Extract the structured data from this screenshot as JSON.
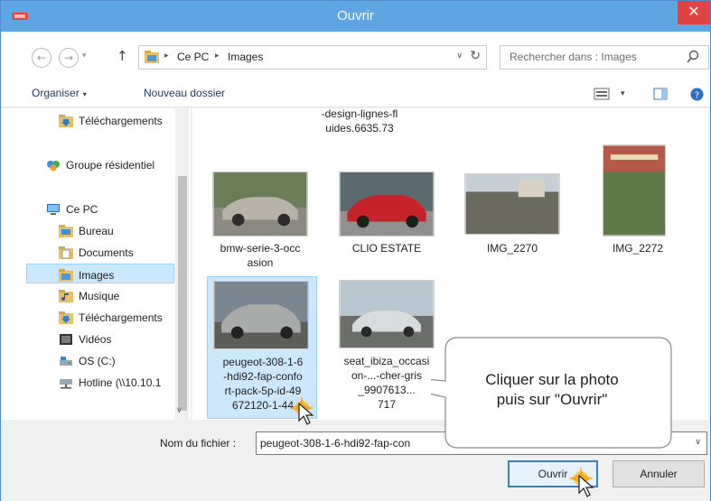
{
  "window": {
    "title": "Ouvrir",
    "close_glyph": "✕",
    "accent": "#5ea5e3"
  },
  "nav": {
    "back_glyph": "←",
    "forward_glyph": "→",
    "dropdown_glyph": "▾",
    "up_glyph": "↑",
    "breadcrumbs": [
      "Ce PC",
      "Images"
    ],
    "crumb_sep": "▸",
    "refresh_glyph": "↻",
    "addr_dropdown": "∨",
    "search_placeholder": "Rechercher dans : Images"
  },
  "commands": {
    "organize": "Organiser",
    "organize_caret": "▾",
    "new_folder": "Nouveau dossier",
    "view_caret": "▾"
  },
  "tree": [
    {
      "label": "Téléchargements",
      "icon": "downloads-folder-icon"
    },
    {
      "label": "Groupe résidentiel",
      "icon": "homegroup-icon"
    },
    {
      "label": "Ce PC",
      "icon": "computer-icon"
    },
    {
      "label": "Bureau",
      "icon": "desktop-folder-icon"
    },
    {
      "label": "Documents",
      "icon": "documents-folder-icon"
    },
    {
      "label": "Images",
      "icon": "pictures-folder-icon"
    },
    {
      "label": "Musique",
      "icon": "music-folder-icon"
    },
    {
      "label": "Téléchargements",
      "icon": "downloads-folder-icon"
    },
    {
      "label": "Vidéos",
      "icon": "videos-folder-icon"
    },
    {
      "label": "OS (C:)",
      "icon": "drive-icon"
    },
    {
      "label": "Hotline (\\\\10.10.1",
      "icon": "network-drive-icon"
    }
  ],
  "tree_scroll": {
    "up": "^",
    "down": "∨"
  },
  "files": {
    "top_partial": [
      "-design-lignes-fl",
      "uides.6635.73"
    ],
    "row1": [
      {
        "label_lines": [
          "bmw-serie-3-occ",
          "asion"
        ]
      },
      {
        "label_lines": [
          "CLIO ESTATE"
        ]
      },
      {
        "label_lines": [
          "IMG_2270"
        ]
      },
      {
        "label_lines": [
          "IMG_2272"
        ]
      }
    ],
    "row2": [
      {
        "label_lines": [
          "peugeot-308-1-6",
          "-hdi92-fap-confo",
          "rt-pack-5p-id-49",
          "672120-1-44"
        ],
        "selected": true
      },
      {
        "label_lines": [
          "seat_ibiza_occasi",
          "on-...-cher-gris",
          "_9907613...",
          "717"
        ]
      }
    ]
  },
  "bottom": {
    "filename_label": "Nom du fichier :",
    "filename_value": "peugeot-308-1-6-hdi92-fap-con",
    "filename_dd": "∨",
    "open_button": "Ouvrir",
    "cancel_button": "Annuler"
  },
  "callout": {
    "line1": "Cliquer sur la photo",
    "line2": "puis sur \"Ouvrir\""
  }
}
